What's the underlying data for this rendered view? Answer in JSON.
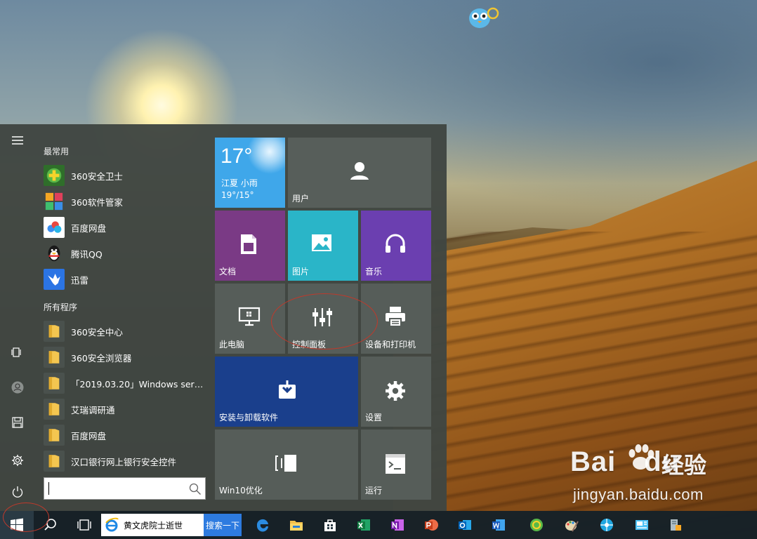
{
  "start_menu": {
    "most_used_header": "最常用",
    "all_programs_header": "所有程序",
    "most_used": [
      {
        "label": "360安全卫士",
        "icon": "360-safe-guard-icon"
      },
      {
        "label": "360软件管家",
        "icon": "360-software-manager-icon"
      },
      {
        "label": "百度网盘",
        "icon": "baidu-netdisk-icon"
      },
      {
        "label": "腾讯QQ",
        "icon": "qq-penguin-icon"
      },
      {
        "label": "迅雷",
        "icon": "xunlei-bird-icon"
      }
    ],
    "all_programs": [
      {
        "label": "360安全中心",
        "icon": "folder-icon"
      },
      {
        "label": "360安全浏览器",
        "icon": "folder-icon"
      },
      {
        "label": "「2019.03.20」Windows server...",
        "icon": "folder-icon"
      },
      {
        "label": "艾瑞调研通",
        "icon": "folder-icon"
      },
      {
        "label": "百度网盘",
        "icon": "folder-icon"
      },
      {
        "label": "汉口银行网上银行安全控件",
        "icon": "folder-icon"
      }
    ],
    "search": {
      "value": "",
      "placeholder": ""
    }
  },
  "tiles": {
    "weather": {
      "temp": "17°",
      "location": "江夏 小雨",
      "range": "19°/15°"
    },
    "user": "用户",
    "documents": "文档",
    "pictures": "图片",
    "music": "音乐",
    "this_pc": "此电脑",
    "control_panel": "控制面板",
    "devices_printers": "设备和打印机",
    "install_uninstall": "安装与卸载软件",
    "settings": "设置",
    "win10_optimize": "Win10优化",
    "run": "运行"
  },
  "taskbar": {
    "ie_search_text": "黄文虎院士逝世",
    "ie_search_button": "搜索一下",
    "apps": [
      "edge-icon",
      "file-explorer-icon",
      "store-icon",
      "excel-icon",
      "onenote-icon",
      "powerpoint-icon",
      "outlook-icon",
      "word-icon",
      "360-browser-icon",
      "paint-icon",
      "network-icon",
      "news-icon",
      "remote-icon"
    ]
  },
  "watermark": {
    "brand": "Bai",
    "brand_suffix": "du",
    "product": "经验",
    "url": "jingyan.baidu.com"
  },
  "colors": {
    "weather_tile": "#3fa7ea",
    "user_tile": "#575e5a",
    "documents_tile": "#7a3a85",
    "pictures_tile": "#2ab5c8",
    "music_tile": "#6b3fb0",
    "install_tile": "#1a3f8c",
    "annotation": "#c0392b"
  }
}
